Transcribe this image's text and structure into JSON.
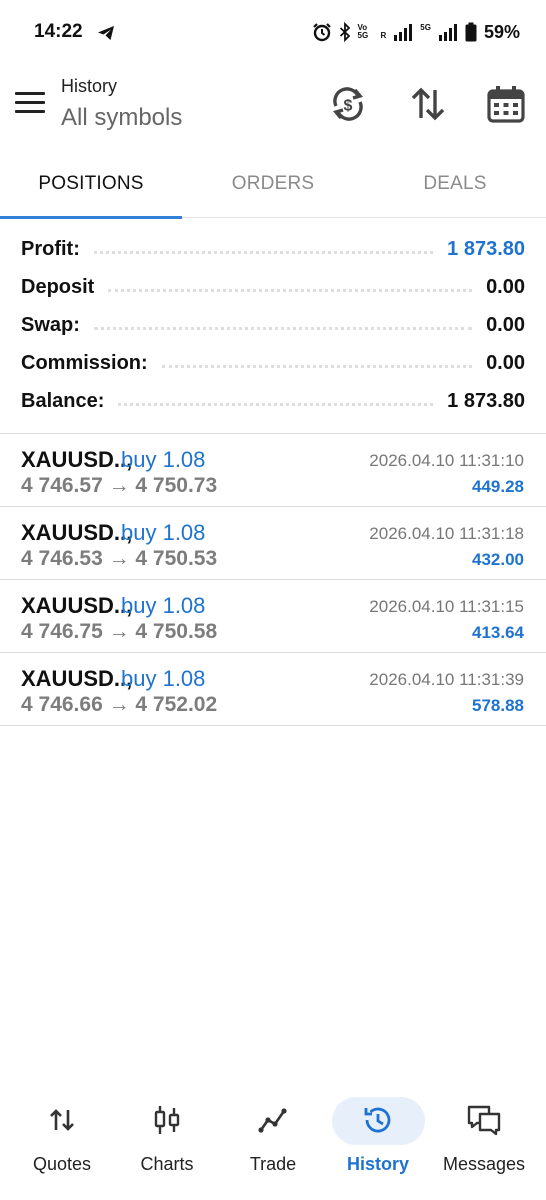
{
  "status_bar": {
    "time": "14:22",
    "battery_pct": "59%",
    "volte_label": "Vo 5G",
    "roaming_label": "R",
    "net_label": "5G"
  },
  "appbar": {
    "title": "History",
    "subtitle": "All symbols",
    "icons": [
      "menu-icon",
      "currency-sync-icon",
      "sort-icon",
      "calendar-icon"
    ]
  },
  "tabs": [
    {
      "label": "POSITIONS",
      "active": true
    },
    {
      "label": "ORDERS",
      "active": false
    },
    {
      "label": "DEALS",
      "active": false
    }
  ],
  "summary": {
    "profit": {
      "label": "Profit:",
      "value": "1 873.80"
    },
    "deposit": {
      "label": "Deposit",
      "value": "0.00"
    },
    "swap": {
      "label": "Swap:",
      "value": "0.00"
    },
    "commission": {
      "label": "Commission:",
      "value": "0.00"
    },
    "balance": {
      "label": "Balance:",
      "value": "1 873.80"
    }
  },
  "positions": [
    {
      "symbol": "XAUUSD..,",
      "side": "buy 1.08",
      "prices": "4 746.57 → 4 750.73",
      "time": "2026.04.10 11:31:10",
      "profit": "449.28"
    },
    {
      "symbol": "XAUUSD..,",
      "side": "buy 1.08",
      "prices": "4 746.53 → 4 750.53",
      "time": "2026.04.10 11:31:18",
      "profit": "432.00"
    },
    {
      "symbol": "XAUUSD..,",
      "side": "buy 1.08",
      "prices": "4 746.75 → 4 750.58",
      "time": "2026.04.10 11:31:15",
      "profit": "413.64"
    },
    {
      "symbol": "XAUUSD..,",
      "side": "buy 1.08",
      "prices": "4 746.66 → 4 752.02",
      "time": "2026.04.10 11:31:39",
      "profit": "578.88"
    }
  ],
  "bottom_nav": [
    {
      "label": "Quotes",
      "icon": "quotes-arrows-icon",
      "active": false
    },
    {
      "label": "Charts",
      "icon": "candlestick-icon",
      "active": false
    },
    {
      "label": "Trade",
      "icon": "trade-line-icon",
      "active": false
    },
    {
      "label": "History",
      "icon": "history-clock-icon",
      "active": true
    },
    {
      "label": "Messages",
      "icon": "messages-icon",
      "active": false
    }
  ],
  "colors": {
    "accent": "#1f73d0",
    "tab_indicator": "#2f80d6",
    "nav_pill": "#e6effa",
    "muted_text": "#7d7d7d"
  }
}
